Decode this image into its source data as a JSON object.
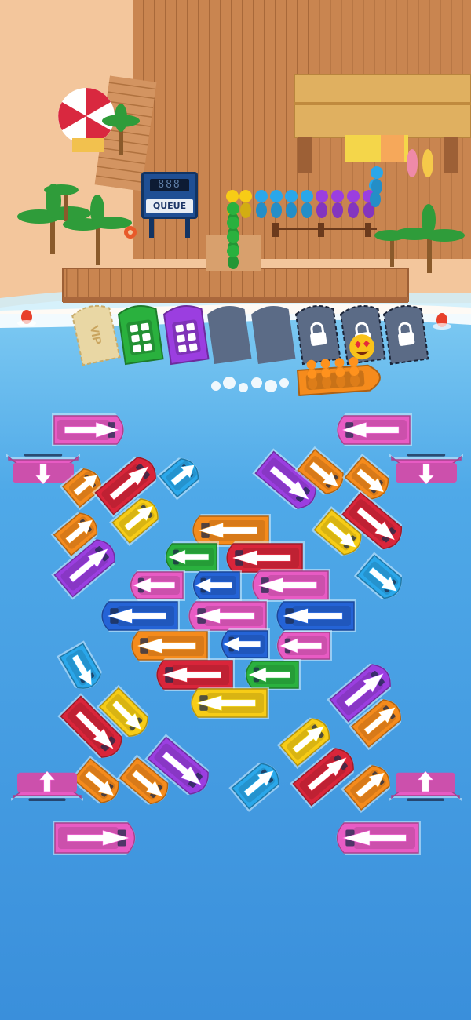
{
  "queue_sign": {
    "counter": "888",
    "label": "QUEUE"
  },
  "vip_slot": {
    "label": "VIP"
  },
  "colors": {
    "pink": "#e85bc4",
    "orange": "#f58b1c",
    "red": "#d9253a",
    "blue": "#2463d6",
    "yellow": "#f7cc16",
    "purple": "#9b3ee0",
    "green": "#2ab13e",
    "cyan": "#2aa7ea",
    "water": "#3f98de",
    "sand": "#f3c69c",
    "wood": "#c8814d"
  },
  "queue_people": [
    "yellow",
    "yellow",
    "cyan",
    "cyan",
    "cyan",
    "cyan",
    "purple",
    "purple",
    "purple",
    "purple",
    "cyan",
    "cyan"
  ],
  "queue_people_green": [
    "green",
    "green",
    "green",
    "green"
  ],
  "dock_slots": [
    {
      "state": "vip"
    },
    {
      "state": "filled",
      "color": "green"
    },
    {
      "state": "filled",
      "color": "purple"
    },
    {
      "state": "empty"
    },
    {
      "state": "empty"
    },
    {
      "state": "locked"
    },
    {
      "state": "locked"
    },
    {
      "state": "locked"
    }
  ],
  "departing_boat": {
    "color": "orange",
    "passengers": 8
  },
  "boats": [
    {
      "color": "pink"
    },
    {
      "color": "pink"
    },
    {
      "color": "pink"
    },
    {
      "color": "pink"
    },
    {
      "color": "orange"
    },
    {
      "color": "red"
    },
    {
      "color": "cyan"
    },
    {
      "color": "orange"
    },
    {
      "color": "yellow"
    },
    {
      "color": "purple"
    },
    {
      "color": "purple"
    },
    {
      "color": "orange"
    },
    {
      "color": "orange"
    },
    {
      "color": "red"
    },
    {
      "color": "yellow"
    },
    {
      "color": "cyan"
    },
    {
      "color": "orange"
    },
    {
      "color": "green"
    },
    {
      "color": "red"
    },
    {
      "color": "pink"
    },
    {
      "color": "blue"
    },
    {
      "color": "pink"
    },
    {
      "color": "blue"
    },
    {
      "color": "pink"
    },
    {
      "color": "blue"
    },
    {
      "color": "orange"
    },
    {
      "color": "blue"
    },
    {
      "color": "pink"
    },
    {
      "color": "red"
    },
    {
      "color": "green"
    },
    {
      "color": "yellow"
    },
    {
      "color": "cyan"
    },
    {
      "color": "red"
    },
    {
      "color": "yellow"
    },
    {
      "color": "purple"
    },
    {
      "color": "orange"
    },
    {
      "color": "orange"
    },
    {
      "color": "pink"
    },
    {
      "color": "pink"
    },
    {
      "color": "purple"
    },
    {
      "color": "orange"
    },
    {
      "color": "yellow"
    },
    {
      "color": "red"
    },
    {
      "color": "cyan"
    },
    {
      "color": "orange"
    },
    {
      "color": "pink"
    },
    {
      "color": "pink"
    }
  ]
}
